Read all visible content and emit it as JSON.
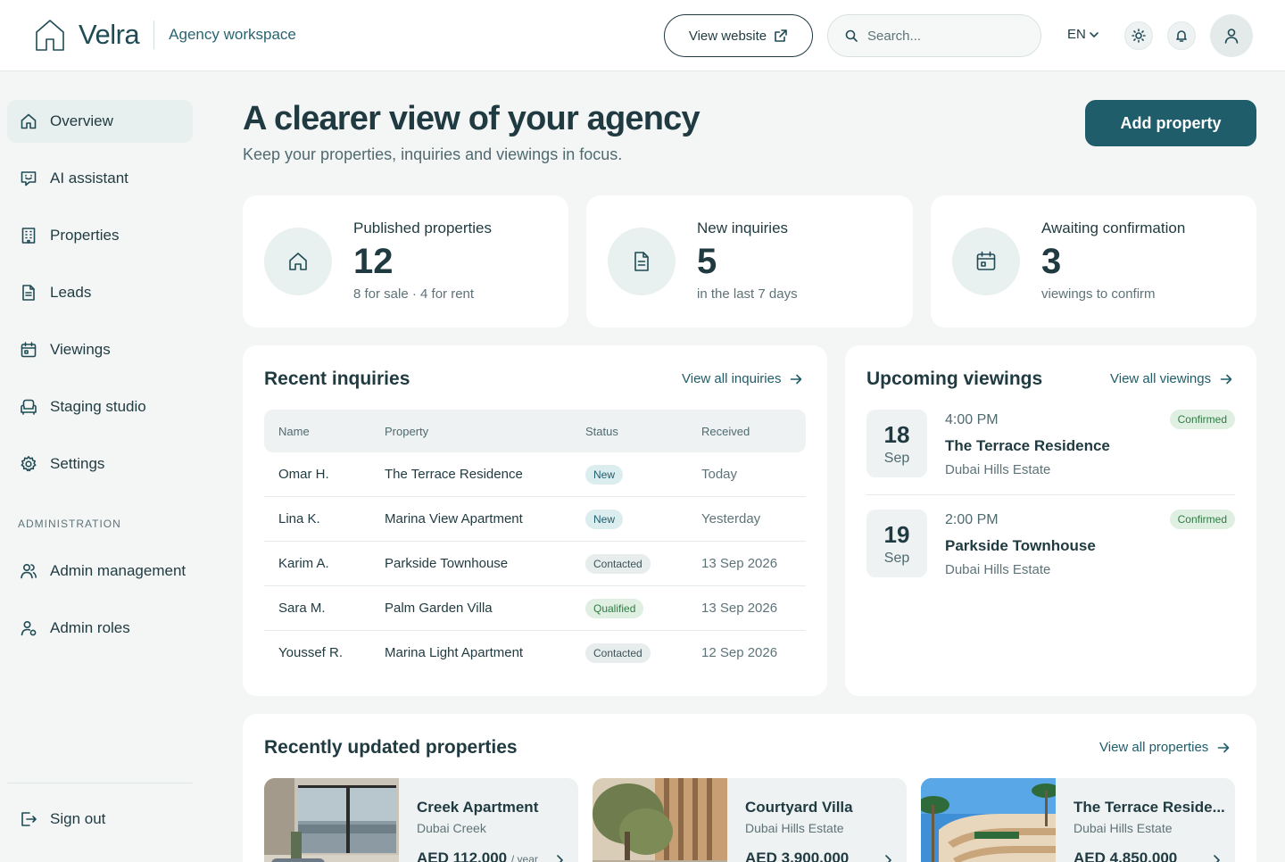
{
  "header": {
    "brand": "Velra",
    "workspace": "Agency workspace",
    "view_website": "View website",
    "search_placeholder": "Search...",
    "language": "EN"
  },
  "sidebar": {
    "items": [
      {
        "label": "Overview",
        "icon": "home-icon",
        "active": true
      },
      {
        "label": "AI assistant",
        "icon": "chat-icon"
      },
      {
        "label": "Properties",
        "icon": "building-icon"
      },
      {
        "label": "Leads",
        "icon": "document-icon"
      },
      {
        "label": "Viewings",
        "icon": "calendar-icon"
      },
      {
        "label": "Staging studio",
        "icon": "armchair-icon"
      },
      {
        "label": "Settings",
        "icon": "gear-icon"
      }
    ],
    "section_label": "ADMINISTRATION",
    "admin_items": [
      {
        "label": "Admin management",
        "icon": "users-icon"
      },
      {
        "label": "Admin roles",
        "icon": "user-role-icon"
      }
    ],
    "sign_out": "Sign out"
  },
  "main": {
    "title": "A clearer view of your agency",
    "subtitle": "Keep your properties, inquiries and viewings in focus.",
    "add_property": "Add property"
  },
  "stats": [
    {
      "label": "Published properties",
      "value": "12",
      "note": "8 for sale · 4 for rent",
      "icon": "home-icon"
    },
    {
      "label": "New inquiries",
      "value": "5",
      "note": "in the last 7 days",
      "icon": "document-icon"
    },
    {
      "label": "Awaiting confirmation",
      "value": "3",
      "note": "viewings to confirm",
      "icon": "calendar-icon"
    }
  ],
  "inquiries": {
    "title": "Recent inquiries",
    "link": "View all inquiries",
    "columns": [
      "Name",
      "Property",
      "Status",
      "Received"
    ],
    "rows": [
      {
        "name": "Omar H.",
        "property": "The Terrace Residence",
        "status": "New",
        "received": "Today"
      },
      {
        "name": "Lina K.",
        "property": "Marina View Apartment",
        "status": "New",
        "received": "Yesterday"
      },
      {
        "name": "Karim A.",
        "property": "Parkside Townhouse",
        "status": "Contacted",
        "received": "13 Sep 2026"
      },
      {
        "name": "Sara M.",
        "property": "Palm Garden Villa",
        "status": "Qualified",
        "received": "13 Sep 2026"
      },
      {
        "name": "Youssef R.",
        "property": "Marina Light Apartment",
        "status": "Contacted",
        "received": "12 Sep 2026"
      }
    ]
  },
  "viewings": {
    "title": "Upcoming viewings",
    "link": "View all viewings",
    "items": [
      {
        "day": "18",
        "month": "Sep",
        "time": "4:00 PM",
        "property": "The Terrace Residence",
        "location": "Dubai Hills Estate",
        "status": "Confirmed"
      },
      {
        "day": "19",
        "month": "Sep",
        "time": "2:00 PM",
        "property": "Parkside Townhouse",
        "location": "Dubai Hills Estate",
        "status": "Confirmed"
      }
    ]
  },
  "recent_properties": {
    "title": "Recently updated properties",
    "link": "View all properties",
    "items": [
      {
        "name": "Creek Apartment",
        "location": "Dubai Creek",
        "price": "AED 112,000",
        "period": "/ year"
      },
      {
        "name": "Courtyard Villa",
        "location": "Dubai Hills Estate",
        "price": "AED 3,900,000",
        "period": ""
      },
      {
        "name": "The Terrace Reside...",
        "location": "Dubai Hills Estate",
        "price": "AED 4,850,000",
        "period": ""
      }
    ]
  },
  "colors": {
    "accent": "#1f5d6a",
    "text": "#1f3a40",
    "background": "#f4f6f6",
    "badge_new": "#dcedf0",
    "badge_qualified": "#dff0e2"
  }
}
